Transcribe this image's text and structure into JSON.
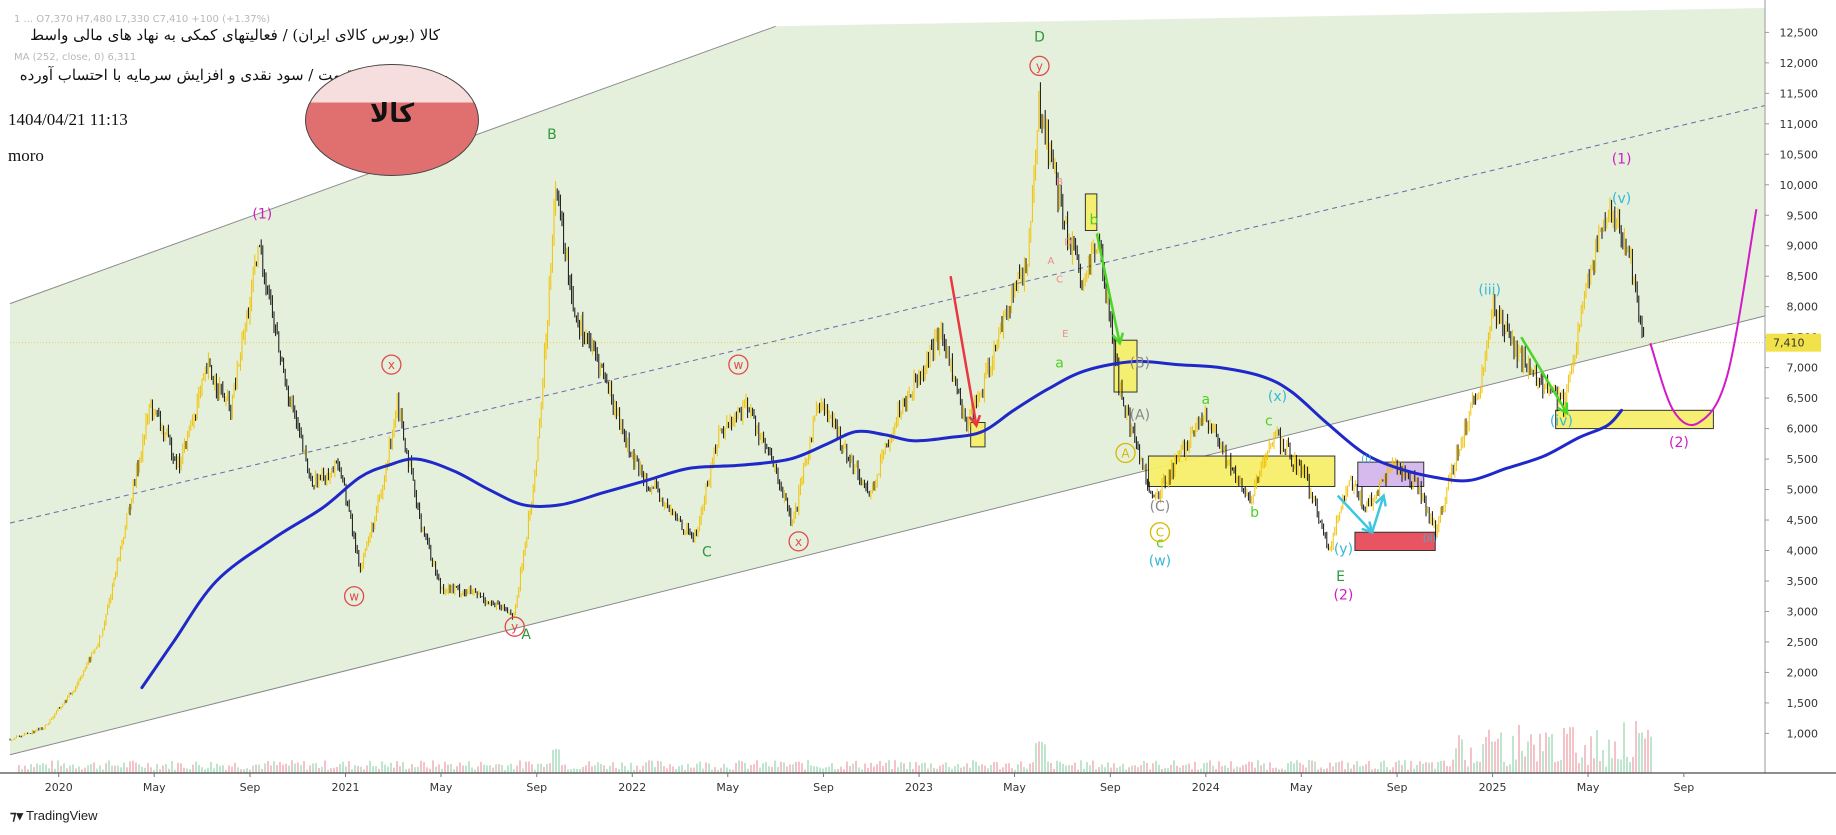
{
  "header": {
    "symbol_line": "کالا (بورس کالای ایران) / فعالیتهای کمکی به نهاد های مالی واسط",
    "subtitle_line": "روزانه / آخرین قیمت / سود نقدی و افزایش سرمایه با احتساب آورده",
    "datetime": "1404/04/21 11:13",
    "author": "moro",
    "ohlc_faint": "1  ...  O7,370  H7,480  L7,330  C7,410  +100 (+1.37%)",
    "ma_faint": "MA (252, close, 0)  6,311",
    "logo_text": "کالا"
  },
  "branding": {
    "name": "TradingView"
  },
  "price_label": "7,410",
  "colors": {
    "channel_fill": "#e4f0dc",
    "moving_average": "#1f28c8",
    "projection": "#d319c9",
    "last_price_label": "#f2e24a",
    "box_yellow": "#f6ee6a",
    "box_red": "#e84b5a",
    "box_purple": "#c8a3e8",
    "logo_fill": "#e07070"
  },
  "chart_data": {
    "type": "candlestick",
    "x_axis_labels": [
      "2020",
      "May",
      "Sep",
      "2021",
      "May",
      "Sep",
      "2022",
      "May",
      "Sep",
      "2023",
      "May",
      "Sep",
      "2024",
      "May",
      "Sep",
      "2025",
      "May",
      "Sep"
    ],
    "y_axis_labels": [
      "12,500",
      "12,000",
      "11,500",
      "11,000",
      "10,500",
      "10,000",
      "9,500",
      "9,000",
      "8,500",
      "8,000",
      "7,500",
      "7,000",
      "6,500",
      "6,000",
      "5,500",
      "5,000",
      "4,500",
      "4,000",
      "3,500",
      "3,000",
      "2,500",
      "2,000",
      "1,500",
      "1,000"
    ],
    "ylim": [
      350,
      12900
    ],
    "xlim": [
      2019.83,
      2025.95
    ],
    "last_price": 7410,
    "price_path": [
      [
        2019.83,
        900
      ],
      [
        2019.95,
        1100
      ],
      [
        2020.05,
        1700
      ],
      [
        2020.15,
        2600
      ],
      [
        2020.25,
        4800
      ],
      [
        2020.32,
        6400
      ],
      [
        2020.42,
        5400
      ],
      [
        2020.52,
        7000
      ],
      [
        2020.6,
        6300
      ],
      [
        2020.7,
        9000
      ],
      [
        2020.78,
        7000
      ],
      [
        2020.88,
        5100
      ],
      [
        2020.98,
        5400
      ],
      [
        2021.05,
        3700
      ],
      [
        2021.13,
        5000
      ],
      [
        2021.18,
        6500
      ],
      [
        2021.25,
        4700
      ],
      [
        2021.33,
        3400
      ],
      [
        2021.45,
        3300
      ],
      [
        2021.52,
        3100
      ],
      [
        2021.59,
        2950
      ],
      [
        2021.66,
        5200
      ],
      [
        2021.7,
        7500
      ],
      [
        2021.73,
        10000
      ],
      [
        2021.8,
        7900
      ],
      [
        2021.9,
        6900
      ],
      [
        2022.0,
        5500
      ],
      [
        2022.12,
        4700
      ],
      [
        2022.22,
        4200
      ],
      [
        2022.3,
        5900
      ],
      [
        2022.4,
        6400
      ],
      [
        2022.5,
        5300
      ],
      [
        2022.56,
        4400
      ],
      [
        2022.65,
        6500
      ],
      [
        2022.75,
        5600
      ],
      [
        2022.83,
        4900
      ],
      [
        2022.92,
        6200
      ],
      [
        2023.0,
        6900
      ],
      [
        2023.08,
        7600
      ],
      [
        2023.16,
        6100
      ],
      [
        2023.22,
        6600
      ],
      [
        2023.3,
        7900
      ],
      [
        2023.38,
        8800
      ],
      [
        2023.42,
        11400
      ],
      [
        2023.5,
        9500
      ],
      [
        2023.57,
        8300
      ],
      [
        2023.63,
        9100
      ],
      [
        2023.7,
        6600
      ],
      [
        2023.76,
        5700
      ],
      [
        2023.82,
        4800
      ],
      [
        2023.9,
        5500
      ],
      [
        2024.0,
        6200
      ],
      [
        2024.08,
        5400
      ],
      [
        2024.15,
        4800
      ],
      [
        2024.24,
        5900
      ],
      [
        2024.35,
        5200
      ],
      [
        2024.43,
        4000
      ],
      [
        2024.5,
        5200
      ],
      [
        2024.56,
        4700
      ],
      [
        2024.66,
        5400
      ],
      [
        2024.74,
        5100
      ],
      [
        2024.8,
        4300
      ],
      [
        2024.88,
        5700
      ],
      [
        2024.96,
        6800
      ],
      [
        2025.0,
        8000
      ],
      [
        2025.08,
        7300
      ],
      [
        2025.16,
        6800
      ],
      [
        2025.25,
        6400
      ],
      [
        2025.33,
        8400
      ],
      [
        2025.4,
        9600
      ],
      [
        2025.47,
        9000
      ],
      [
        2025.53,
        7410
      ]
    ],
    "moving_average_path": [
      [
        2020.29,
        1750
      ],
      [
        2020.4,
        2500
      ],
      [
        2020.55,
        3500
      ],
      [
        2020.75,
        4200
      ],
      [
        2020.92,
        4700
      ],
      [
        2021.05,
        5200
      ],
      [
        2021.15,
        5400
      ],
      [
        2021.25,
        5500
      ],
      [
        2021.38,
        5300
      ],
      [
        2021.5,
        5000
      ],
      [
        2021.62,
        4750
      ],
      [
        2021.75,
        4750
      ],
      [
        2021.9,
        4950
      ],
      [
        2022.05,
        5150
      ],
      [
        2022.2,
        5350
      ],
      [
        2022.38,
        5400
      ],
      [
        2022.55,
        5500
      ],
      [
        2022.68,
        5750
      ],
      [
        2022.78,
        5950
      ],
      [
        2022.88,
        5900
      ],
      [
        2022.98,
        5800
      ],
      [
        2023.1,
        5850
      ],
      [
        2023.22,
        5950
      ],
      [
        2023.33,
        6300
      ],
      [
        2023.45,
        6650
      ],
      [
        2023.58,
        6950
      ],
      [
        2023.75,
        7100
      ],
      [
        2023.9,
        7050
      ],
      [
        2024.05,
        7000
      ],
      [
        2024.2,
        6850
      ],
      [
        2024.3,
        6600
      ],
      [
        2024.42,
        6100
      ],
      [
        2024.55,
        5600
      ],
      [
        2024.67,
        5350
      ],
      [
        2024.8,
        5200
      ],
      [
        2024.92,
        5150
      ],
      [
        2025.05,
        5350
      ],
      [
        2025.18,
        5550
      ],
      [
        2025.3,
        5850
      ],
      [
        2025.4,
        6050
      ],
      [
        2025.45,
        6300
      ]
    ],
    "projection_path": [
      [
        2025.55,
        7400
      ],
      [
        2025.63,
        6300
      ],
      [
        2025.72,
        6100
      ],
      [
        2025.82,
        6900
      ],
      [
        2025.92,
        9600
      ]
    ],
    "channel": {
      "upper": [
        [
          2019.83,
          8050
        ],
        [
          2022.5,
          12600
        ]
      ],
      "lower": [
        [
          2019.83,
          650
        ],
        [
          2025.95,
          7850
        ]
      ],
      "mid": [
        [
          2019.83,
          4450
        ],
        [
          2025.95,
          11300
        ]
      ]
    },
    "boxes": [
      {
        "color": "yellow",
        "x1": 2023.18,
        "x2": 2023.23,
        "y1": 5700,
        "y2": 6100
      },
      {
        "color": "yellow",
        "x1": 2023.58,
        "x2": 2023.62,
        "y1": 9250,
        "y2": 9850
      },
      {
        "color": "yellow",
        "x1": 2023.68,
        "x2": 2023.76,
        "y1": 6600,
        "y2": 7450
      },
      {
        "color": "yellow",
        "x1": 2023.8,
        "x2": 2024.45,
        "y1": 5050,
        "y2": 5550
      },
      {
        "color": "red",
        "x1": 2024.52,
        "x2": 2024.8,
        "y1": 4000,
        "y2": 4300
      },
      {
        "color": "purple",
        "x1": 2024.53,
        "x2": 2024.76,
        "y1": 5050,
        "y2": 5450
      },
      {
        "color": "yellow",
        "x1": 2025.22,
        "x2": 2025.77,
        "y1": 6000,
        "y2": 6300
      }
    ],
    "arrows": [
      {
        "color": "red",
        "from": [
          2023.11,
          8500
        ],
        "to": [
          2023.2,
          6050
        ]
      },
      {
        "color": "green",
        "from": [
          2023.62,
          9200
        ],
        "to": [
          2023.7,
          7400
        ]
      },
      {
        "color": "green",
        "from": [
          2025.1,
          7500
        ],
        "to": [
          2025.26,
          6250
        ]
      },
      {
        "color": "cyan",
        "from": [
          2024.46,
          4900
        ],
        "to": [
          2024.58,
          4300
        ]
      },
      {
        "color": "cyan",
        "from": [
          2024.58,
          4300
        ],
        "to": [
          2024.62,
          4900
        ]
      }
    ],
    "wave_labels": [
      {
        "text": "(1)",
        "color": "magenta",
        "x": 2020.71,
        "y": 9450
      },
      {
        "text": "B",
        "color": "green",
        "x": 2021.72,
        "y": 10750
      },
      {
        "text": "D",
        "color": "green",
        "x": 2023.42,
        "y": 12350
      },
      {
        "text": "(1)",
        "color": "magenta",
        "x": 2025.45,
        "y": 10350
      },
      {
        "text": "(v)",
        "color": "cyan",
        "x": 2025.45,
        "y": 9700
      },
      {
        "text": "(iii)",
        "color": "cyan",
        "x": 2024.99,
        "y": 8200
      },
      {
        "text": "(iv)",
        "color": "cyan",
        "x": 2025.24,
        "y": 6050
      },
      {
        "text": "(x)",
        "color": "cyan",
        "x": 2024.25,
        "y": 6450
      },
      {
        "text": "(w)",
        "color": "cyan",
        "x": 2023.84,
        "y": 3750
      },
      {
        "text": "(y)",
        "color": "cyan",
        "x": 2024.48,
        "y": 3950
      },
      {
        "text": "(2)",
        "color": "magenta",
        "x": 2025.65,
        "y": 5700
      },
      {
        "text": "(2)",
        "color": "magenta",
        "x": 2024.48,
        "y": 3200
      },
      {
        "text": "E",
        "color": "green",
        "x": 2024.47,
        "y": 3500
      },
      {
        "text": "A",
        "color": "green",
        "x": 2021.63,
        "y": 2550
      },
      {
        "text": "C",
        "color": "green",
        "x": 2022.26,
        "y": 3900
      },
      {
        "text": "a",
        "color": "lime",
        "x": 2023.49,
        "y": 7000
      },
      {
        "text": "a",
        "color": "lime",
        "x": 2024.0,
        "y": 6400
      },
      {
        "text": "b",
        "color": "lime",
        "x": 2024.17,
        "y": 4550
      },
      {
        "text": "c",
        "color": "lime",
        "x": 2024.22,
        "y": 6050
      },
      {
        "text": "c",
        "color": "lime",
        "x": 2023.84,
        "y": 4050
      },
      {
        "text": "b",
        "color": "lime",
        "x": 2023.61,
        "y": 9350
      },
      {
        "text": "(C)",
        "color": "gray",
        "x": 2023.84,
        "y": 4650
      },
      {
        "text": "(A)",
        "color": "gray",
        "x": 2023.77,
        "y": 6150
      },
      {
        "text": "(B)",
        "color": "gray",
        "x": 2023.77,
        "y": 7000
      }
    ],
    "circled_labels": [
      {
        "text": "x",
        "color": "red",
        "x": 2021.16,
        "y": 7050
      },
      {
        "text": "w",
        "color": "red",
        "x": 2021.03,
        "y": 3250
      },
      {
        "text": "y",
        "color": "red",
        "x": 2021.59,
        "y": 2750
      },
      {
        "text": "w",
        "color": "red",
        "x": 2022.37,
        "y": 7050
      },
      {
        "text": "x",
        "color": "red",
        "x": 2022.58,
        "y": 4150
      },
      {
        "text": "y",
        "color": "red",
        "x": 2023.42,
        "y": 11950
      },
      {
        "text": "A",
        "color": "gold",
        "x": 2023.72,
        "y": 5600
      },
      {
        "text": "C",
        "color": "gold",
        "x": 2023.84,
        "y": 4300
      }
    ],
    "small_labels": [
      {
        "text": "B",
        "color": "salmon",
        "x": 2023.49,
        "y": 10000
      },
      {
        "text": "D",
        "color": "salmon",
        "x": 2023.52,
        "y": 9000
      },
      {
        "text": "A",
        "color": "salmon",
        "x": 2023.46,
        "y": 8700
      },
      {
        "text": "C",
        "color": "salmon",
        "x": 2023.49,
        "y": 8400
      },
      {
        "text": "E",
        "color": "salmon",
        "x": 2023.51,
        "y": 7500
      },
      {
        "text": "(i)",
        "color": "cyan",
        "x": 2024.56,
        "y": 5450
      },
      {
        "text": "(ii)",
        "color": "cyan",
        "x": 2024.78,
        "y": 4150
      }
    ]
  }
}
